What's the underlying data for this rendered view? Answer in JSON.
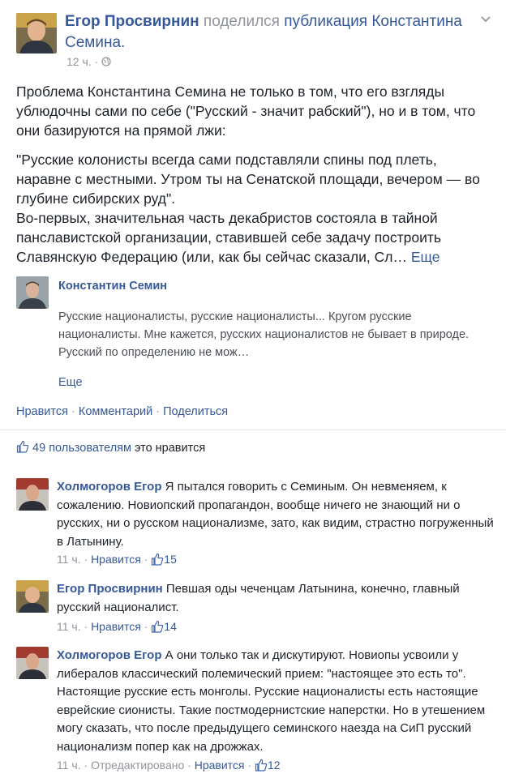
{
  "post": {
    "author": "Егор Просвирнин",
    "verb": "поделился",
    "object_prefix": "публикация",
    "object_name": "Константина Семина.",
    "time": "12 ч. ·",
    "globe_icon": "globe-icon",
    "paragraph1": "Проблема Константина Семина не только в том, что его взгляды ублюдочны сами по себе (\"Русский - значит рабский\"), но и в том, что они базируются на прямой лжи:",
    "paragraph2": "\"Русские колонисты всегда сами подставляли спины под плеть, наравне с местными. Утром ты на Сенатской площади, вечером — во глубине сибирских руд\".",
    "paragraph3": "Во-первых, значительная часть декабристов состояла в тайной панславистской организации, ставившей себе задачу построить Славянскую Федерацию (или, как бы сейчас сказали, Сл…",
    "more_label": "Еще"
  },
  "shared": {
    "author": "Константин Семин",
    "text": "Русские националисты, русские националисты... Кругом русские националисты. Мне кажется, русских националистов не бывает в природе. Русский по определению не мож…",
    "more_label": "Еще"
  },
  "actions": {
    "like": "Нравится",
    "comment": "Комментарий",
    "share": "Поделиться",
    "separator": " · "
  },
  "likes": {
    "count_text": "49 пользователям",
    "suffix": "это нравится"
  },
  "comments": [
    {
      "author": "Холмогоров Егор",
      "text": "Я пытался говорить с Семиным. Он невменяем, к сожалению. Новиопский пропагандон, вообще ничего не знающий ни о русских, ни о русском национализме, зато, как видим, страстно погруженный в Латынину.",
      "time": "11 ч.",
      "edited": "",
      "like_label": "Нравится",
      "likes": "15"
    },
    {
      "author": "Егор Просвирнин",
      "text": "Певшая оды чеченцам Латынина, конечно, главный русский националист.",
      "time": "11 ч.",
      "edited": "",
      "like_label": "Нравится",
      "likes": "14"
    },
    {
      "author": "Холмогоров Егор",
      "text": "А они только так и дискутируют. Новиопы усвоили у либералов классический полемический прием: \"настоящее это есть то\". Настоящие русские есть монголы. Русские националисты есть настоящие еврейские сионисты. Такие постмодернистские наперстки. Но в утешением могу сказать, что после предыдущего семинского наезда на СиП русский национализм попер как на дрожжах.",
      "time": "11 ч.",
      "edited": "Отредактировано",
      "like_label": "Нравится",
      "likes": "12"
    }
  ],
  "colors": {
    "link": "#365899",
    "meta": "#90949c",
    "text": "#1d2129"
  }
}
